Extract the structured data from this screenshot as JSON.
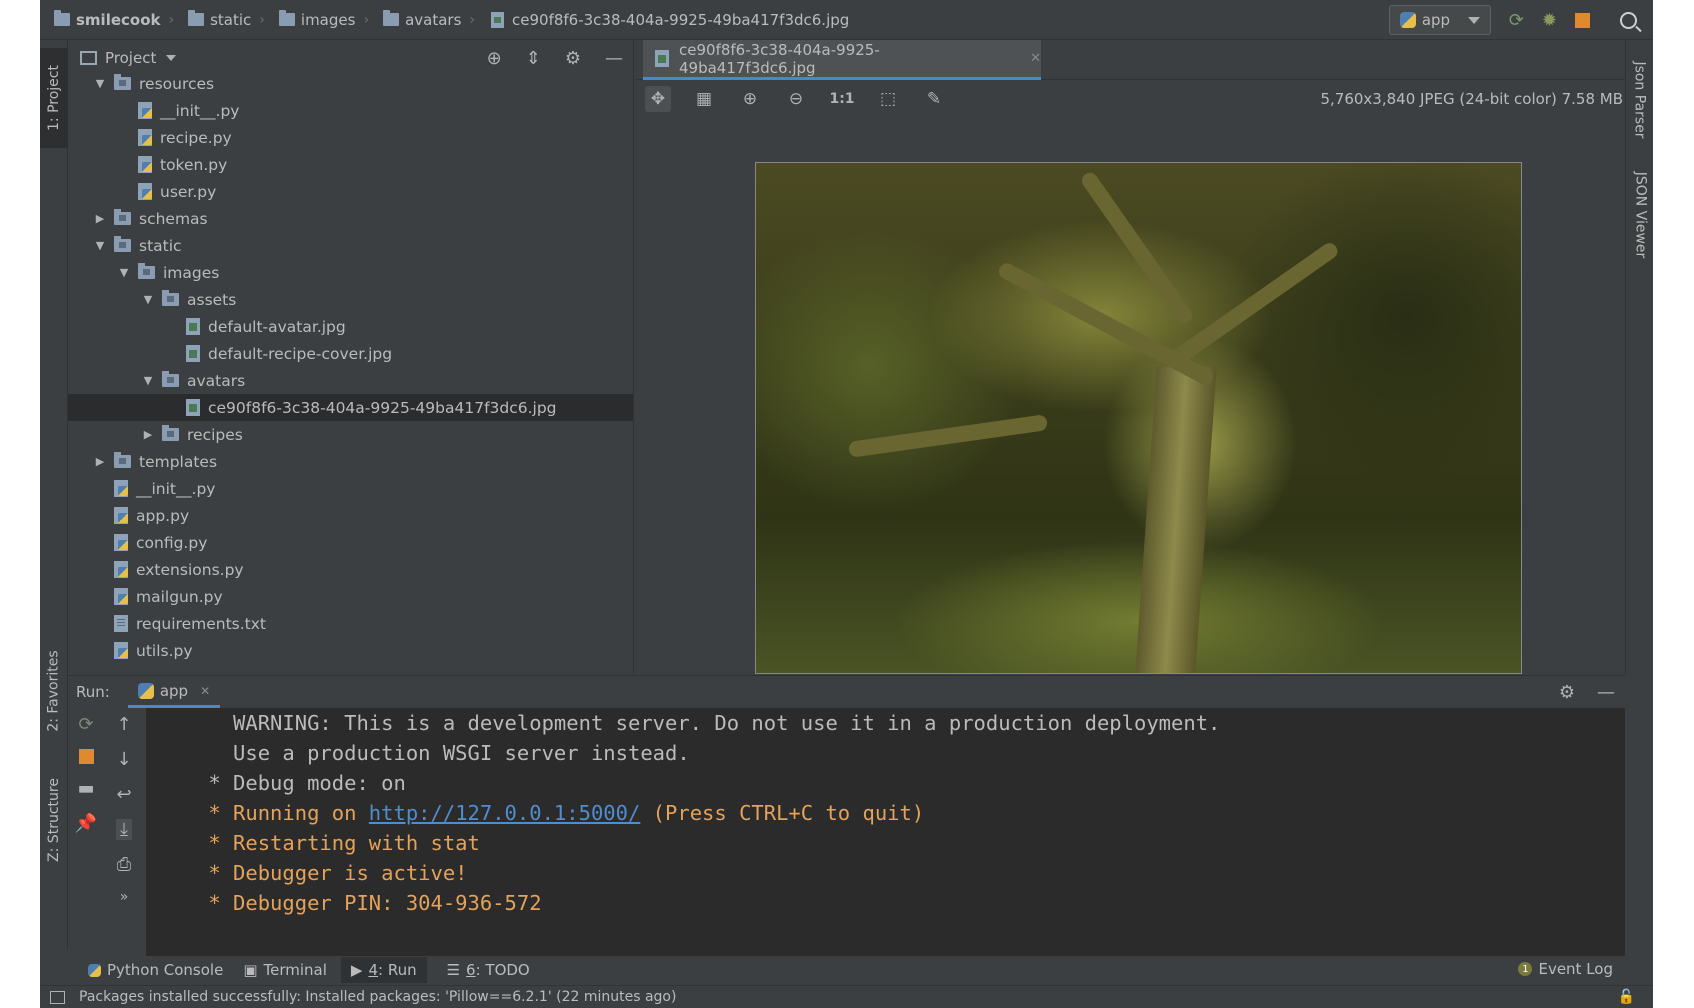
{
  "breadcrumbs": [
    {
      "label": "smilecook",
      "bold": true
    },
    {
      "label": "static"
    },
    {
      "label": "images"
    },
    {
      "label": "avatars"
    }
  ],
  "breadcrumb_file": "ce90f8f6-3c38-404a-9925-49ba417f3dc6.jpg",
  "run_config": {
    "label": "app"
  },
  "left_tabs": {
    "project": "1: Project",
    "favorites": "2: Favorites",
    "structure": "Z: Structure"
  },
  "right_tabs": {
    "json_parser": "Json Parser",
    "json_viewer": "JSON Viewer"
  },
  "project_panel": {
    "title": "Project"
  },
  "tree": [
    {
      "label": "resources",
      "type": "dir",
      "depth": 1,
      "expanded": true
    },
    {
      "label": "__init__.py",
      "type": "py",
      "depth": 2
    },
    {
      "label": "recipe.py",
      "type": "py",
      "depth": 2
    },
    {
      "label": "token.py",
      "type": "py",
      "depth": 2
    },
    {
      "label": "user.py",
      "type": "py",
      "depth": 2
    },
    {
      "label": "schemas",
      "type": "dir",
      "depth": 1,
      "expanded": false
    },
    {
      "label": "static",
      "type": "dir",
      "depth": 1,
      "expanded": true
    },
    {
      "label": "images",
      "type": "dir",
      "depth": 2,
      "expanded": true
    },
    {
      "label": "assets",
      "type": "dir",
      "depth": 3,
      "expanded": true
    },
    {
      "label": "default-avatar.jpg",
      "type": "img",
      "depth": 4
    },
    {
      "label": "default-recipe-cover.jpg",
      "type": "img",
      "depth": 4
    },
    {
      "label": "avatars",
      "type": "dir",
      "depth": 3,
      "expanded": true
    },
    {
      "label": "ce90f8f6-3c38-404a-9925-49ba417f3dc6.jpg",
      "type": "img",
      "depth": 4,
      "selected": true
    },
    {
      "label": "recipes",
      "type": "dir",
      "depth": 3,
      "expanded": false
    },
    {
      "label": "templates",
      "type": "dir",
      "depth": 1,
      "expanded": false
    },
    {
      "label": "__init__.py",
      "type": "py",
      "depth": 1
    },
    {
      "label": "app.py",
      "type": "py",
      "depth": 1
    },
    {
      "label": "config.py",
      "type": "py",
      "depth": 1
    },
    {
      "label": "extensions.py",
      "type": "py",
      "depth": 1
    },
    {
      "label": "mailgun.py",
      "type": "py",
      "depth": 1
    },
    {
      "label": "requirements.txt",
      "type": "txt",
      "depth": 1
    },
    {
      "label": "utils.py",
      "type": "py",
      "depth": 1
    }
  ],
  "editor": {
    "tab_label": "ce90f8f6-3c38-404a-9925-49ba417f3dc6.jpg",
    "image_info": "5,760x3,840 JPEG (24-bit color) 7.58 MB",
    "actual_size_label": "1:1"
  },
  "run": {
    "label": "Run:",
    "tab": "app",
    "lines": [
      {
        "text": "   WARNING: This is a development server. Do not use it in a production deployment.",
        "style": "w"
      },
      {
        "text": "   Use a production WSGI server instead.",
        "style": "w"
      },
      {
        "text": " * Debug mode: on",
        "style": "w"
      },
      {
        "text": " * Restarting with stat",
        "style": "o"
      },
      {
        "text": " * Debugger is active!",
        "style": "o"
      },
      {
        "text": " * Debugger PIN: 304-936-572",
        "style": "o"
      }
    ],
    "running_prefix": " * Running on ",
    "running_url": "http://127.0.0.1:5000/",
    "running_suffix": " (Press CTRL+C to quit)"
  },
  "bottom_tools": {
    "python_console": "Python Console",
    "terminal": "Terminal",
    "run_num": "4",
    "run_label": ": Run",
    "todo_num": "6",
    "todo_label": ": TODO",
    "event_log": "Event Log",
    "event_count": "1"
  },
  "status": "Packages installed successfully: Installed packages: 'Pillow==6.2.1' (22 minutes ago)"
}
